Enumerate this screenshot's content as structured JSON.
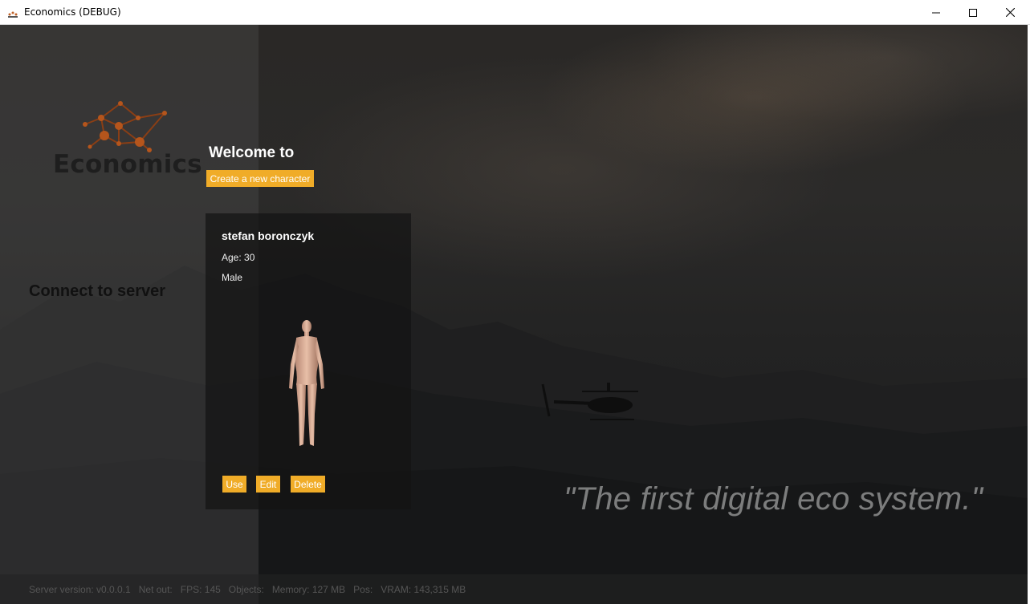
{
  "window": {
    "title": "Economics (DEBUG)",
    "controls": {
      "minimize_icon": "minimize-icon",
      "maximize_icon": "maximize-icon",
      "close_icon": "close-icon"
    }
  },
  "logo": {
    "text": "Economics",
    "accent": "#b5551c",
    "wordmark_color": "#1e1e1e"
  },
  "connect": {
    "title": "Connect to server"
  },
  "welcome": {
    "title": "Welcome to",
    "create_button": "Create a new character"
  },
  "character": {
    "name": "stefan boronczyk",
    "age": "Age: 30",
    "gender": "Male",
    "buttons": {
      "use": "Use",
      "edit": "Edit",
      "delete": "Delete"
    }
  },
  "quote": "\"The first digital eco system.\"",
  "status": {
    "server_version": "Server version: v0.0.0.1",
    "net_out": "Net out:",
    "fps": "FPS: 145",
    "objects": "Objects:",
    "memory": "Memory: 127 MB",
    "pos": "Pos:",
    "vram": "VRAM: 143,315 MB"
  },
  "colors": {
    "accent": "#f0ac28",
    "card_bg": "#141414",
    "panel_bg": "#464646"
  }
}
